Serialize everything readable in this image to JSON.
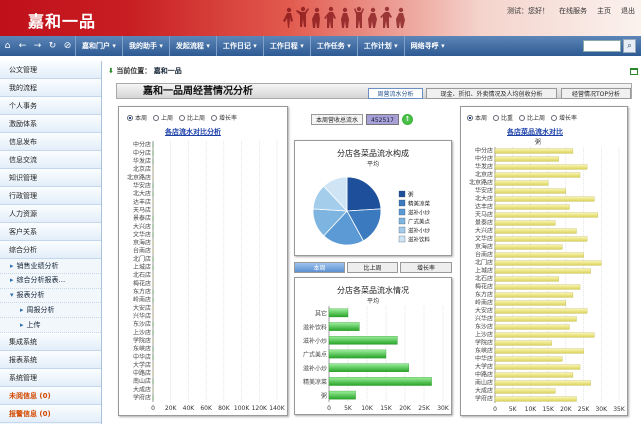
{
  "header": {
    "logo": "嘉和一品",
    "links": [
      "测试：您好！",
      "在线服务",
      "主页",
      "退出"
    ]
  },
  "nav": {
    "items": [
      "嘉和门户",
      "我的助手",
      "发起流程",
      "工作日记",
      "工作日程",
      "工作任务",
      "工作计划",
      "网络寻呼"
    ],
    "search_placeholder": ""
  },
  "sidebar": {
    "items_top": [
      "公文管理",
      "我的流程",
      "个人事务",
      "激励体系",
      "信息发布",
      "信息交流",
      "知识管理",
      "行政管理",
      "人力资源",
      "客户关系",
      "综合分析"
    ],
    "sub_items": [
      "销售业绩分析",
      "综合分析报表...",
      "报表分析"
    ],
    "sub_sub_items": [
      "周报分析",
      "上传"
    ],
    "items_bottom": [
      "集成系统",
      "报表系统",
      "系统管理"
    ],
    "alerts": [
      "未阅信息 (0)",
      "报警信息 (0)"
    ]
  },
  "breadcrumb": {
    "label": "当前位置：",
    "value": "嘉和一品"
  },
  "page": {
    "title": "嘉和一品周经营情况分析",
    "tabs": [
      "周营流水分析",
      "现金、折扣、外卖情况及人均创收分析",
      "经营情况TOP分析"
    ]
  },
  "left_panel": {
    "radios": [
      "本周",
      "上周",
      "比上周",
      "增长率"
    ],
    "title": "各店流水对比分析"
  },
  "total": {
    "label": "本周营收总流水",
    "value": "452517"
  },
  "pie_panel": {
    "title": "分店各菜品流水构成",
    "subtitle": "平均",
    "legend": [
      "粥",
      "精美凉菜",
      "滋补小炒",
      "广式美点",
      "滋补小炒",
      "滋补饮料"
    ]
  },
  "mid_tabs": [
    "本周",
    "比上周",
    "增长率"
  ],
  "bar_panel": {
    "title": "分店各菜品流水情况",
    "subtitle": "平均"
  },
  "right_panel": {
    "radios": [
      "本周",
      "比重",
      "比上周",
      "增长率"
    ],
    "title": "各店菜品流水对比",
    "subtitle": "粥"
  },
  "colors": {
    "green": "#3cb93c",
    "yellow": "#e6e07a",
    "navy": "#1b3f8a",
    "header_red": "#c0101a"
  },
  "chart_data": [
    {
      "type": "bar",
      "orientation": "horizontal",
      "categories": [
        "中分店",
        "中分店",
        "华发店",
        "北京店",
        "北京路店",
        "华安店",
        "北大店",
        "达丰店",
        "天马店",
        "景泰店",
        "大兴店",
        "文华店",
        "京海店",
        "台南店",
        "北门店",
        "上城店",
        "北石店",
        "梅花店",
        "东方店",
        "岭南店",
        "大安店",
        "兴华店",
        "东沙店",
        "上沙店",
        "学院店",
        "东峡店",
        "中华店",
        "大学店",
        "中路店",
        "南山店",
        "大成店",
        "学府店"
      ],
      "series": [
        {
          "values": [
            65,
            90,
            102,
            85,
            80,
            78,
            62,
            88,
            95,
            110,
            72,
            96,
            88,
            92,
            100,
            84,
            62,
            58,
            80,
            72,
            98,
            90,
            110,
            85,
            66,
            60,
            78,
            82,
            94,
            74,
            90,
            120
          ]
        },
        {
          "values": [
            55,
            80,
            92,
            78,
            72,
            70,
            58,
            79,
            85,
            99,
            65,
            88,
            80,
            84,
            90,
            76,
            56,
            52,
            72,
            66,
            88,
            82,
            100,
            78,
            60,
            54,
            70,
            75,
            86,
            68,
            82,
            110
          ]
        }
      ],
      "xticks": [
        "0",
        "20K",
        "40K",
        "60K",
        "80K",
        "100K",
        "120K",
        "140K"
      ],
      "xlim": [
        0,
        140000
      ]
    },
    {
      "type": "pie",
      "labels": [
        "粥",
        "精美凉菜",
        "滋补小炒",
        "广式美点",
        "滋补小炒",
        "滋补饮料"
      ],
      "values": [
        24,
        18,
        20,
        14,
        12,
        12
      ]
    },
    {
      "type": "bar",
      "orientation": "horizontal",
      "categories": [
        "其它",
        "滋补饮料",
        "滋补小炒",
        "广式美点",
        "滋补小炒",
        "精美凉菜",
        "粥"
      ],
      "values": [
        5000,
        8000,
        18000,
        15000,
        21000,
        27000,
        7000
      ],
      "xticks": [
        "0",
        "5K",
        "10K",
        "15K",
        "20K",
        "25K",
        "30K"
      ],
      "xlim": [
        0,
        30000
      ]
    },
    {
      "type": "bar",
      "orientation": "horizontal",
      "categories": [
        "中分店",
        "中分店",
        "华发店",
        "北京店",
        "北京路店",
        "华安店",
        "北大店",
        "达丰店",
        "天马店",
        "景泰店",
        "大兴店",
        "文华店",
        "京海店",
        "台南店",
        "北门店",
        "上城店",
        "北石店",
        "梅花店",
        "东方店",
        "岭南店",
        "大安店",
        "兴华店",
        "东沙店",
        "上沙店",
        "学院店",
        "东峡店",
        "中华店",
        "大学店",
        "中路店",
        "南山店",
        "大成店",
        "学府店"
      ],
      "values": [
        22000,
        18000,
        26000,
        24000,
        15000,
        20000,
        28000,
        21000,
        29000,
        17000,
        23000,
        26000,
        19000,
        25000,
        30000,
        27000,
        18000,
        24000,
        22000,
        20000,
        26000,
        23000,
        21000,
        28000,
        16000,
        25000,
        19000,
        24000,
        22000,
        27000,
        17000,
        23000
      ],
      "xticks": [
        "0",
        "5K",
        "10K",
        "15K",
        "20K",
        "25K",
        "30K",
        "35K"
      ],
      "xlim": [
        0,
        35000
      ]
    }
  ]
}
